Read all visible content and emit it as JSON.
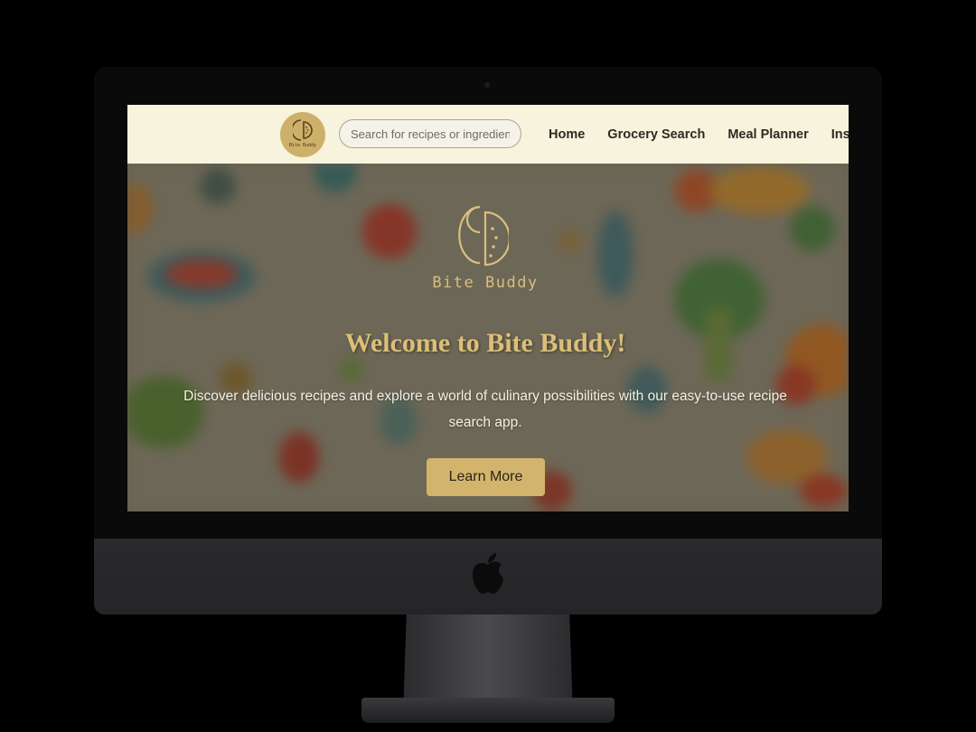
{
  "colors": {
    "navbar_bg": "#f7f3dc",
    "accent_gold": "#d2b46c",
    "title_gold": "#dcbf78",
    "hero_text": "#f4f1e6"
  },
  "navbar": {
    "logo": {
      "icon": "bite-buddy-logo-icon",
      "text": "Bite Buddy"
    },
    "search": {
      "placeholder": "Search for recipes or ingredients"
    },
    "links": [
      {
        "label": "Home"
      },
      {
        "label": "Grocery Search"
      },
      {
        "label": "Meal Planner"
      },
      {
        "label": "Inspiration"
      }
    ]
  },
  "hero": {
    "logo_icon": "bite-buddy-logo-icon",
    "brand": "Bite Buddy",
    "title": "Welcome to Bite Buddy!",
    "description": "Discover delicious recipes and explore a world of culinary possibilities with our easy-to-use recipe search app.",
    "cta_label": "Learn More"
  },
  "device": {
    "logo_icon": "apple-logo-icon"
  }
}
